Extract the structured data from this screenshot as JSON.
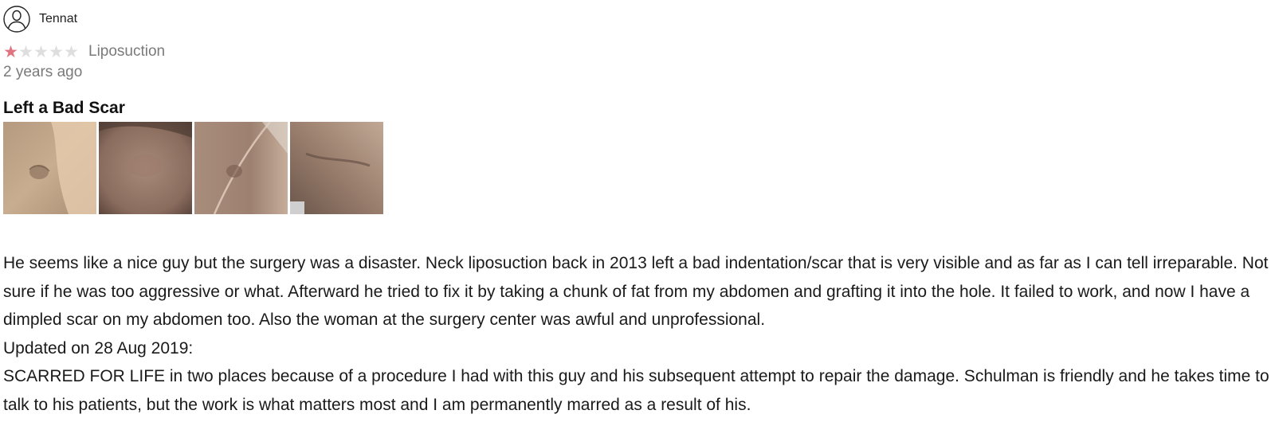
{
  "reviewer": {
    "avatar_icon": "user-avatar-icon",
    "name": "Tennat"
  },
  "rating": {
    "value": 1,
    "max": 5,
    "filled_color": "#e0737f",
    "empty_color": "#dedede"
  },
  "procedure": "Liposuction",
  "time_ago": "2 years ago",
  "title": "Left a Bad Scar",
  "photos": [
    {
      "icon": "review-photo-1"
    },
    {
      "icon": "review-photo-2"
    },
    {
      "icon": "review-photo-3"
    },
    {
      "icon": "review-photo-4"
    }
  ],
  "body": {
    "paragraph_1": "He seems like a nice guy but the surgery was a disaster. Neck liposuction back in 2013 left a bad indentation/scar that is very visible and as far as I can tell irreparable. Not sure if he was too aggressive or what. Afterward he tried to fix it by taking a chunk of fat from my abdomen and grafting it into the hole. It failed to work, and now I have a dimpled scar on my abdomen too. Also the woman at the surgery center was awful and unprofessional.",
    "update_label": "Updated on 28 Aug 2019:",
    "paragraph_2": "SCARRED FOR LIFE in two places because of a procedure I had with this guy and his subsequent attempt to repair the damage. Schulman is friendly and he takes time to talk to his patients, but the work is what matters most and I am permanently marred as a result of his."
  }
}
